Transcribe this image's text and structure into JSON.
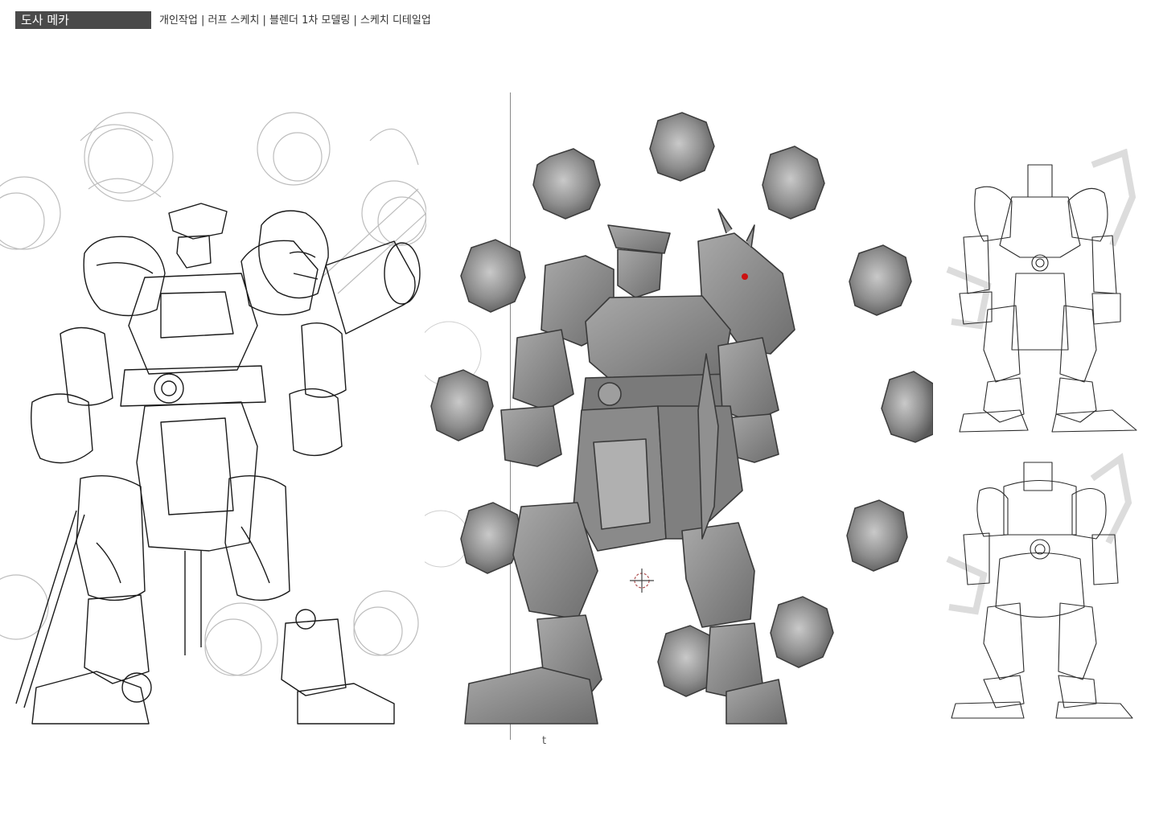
{
  "header": {
    "title": "도사 메카",
    "subtitle": "개인작업 | 러프 스케치 | 블렌더 1차 모델링 | 스케치 디테일업"
  },
  "canvas": {
    "cursor_glyph": "t"
  },
  "colors": {
    "badge_bg": "#4a4a4a",
    "sketch_line": "#1a1a1a",
    "sketch_light": "#b8b8b8",
    "model_gray": "#8c8c8c",
    "model_dark": "#5f5f5f",
    "model_light": "#b5b5b5",
    "eye_red": "#cc1111"
  },
  "icons": {
    "cursor": "crosshair-3d-cursor-icon"
  }
}
